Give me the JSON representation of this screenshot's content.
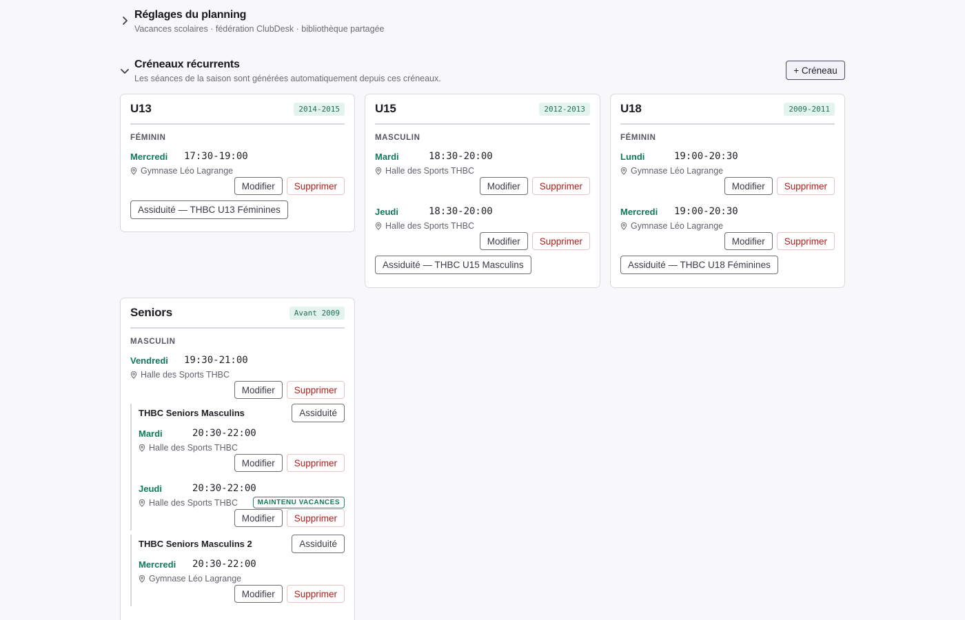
{
  "settings": {
    "title": "Réglages du planning",
    "subtitle": "Vacances scolaires · fédération ClubDesk · bibliothèque partagée"
  },
  "recurring": {
    "title": "Créneaux récurrents",
    "subtitle": "Les séances de la saison sont générées automatiquement depuis ces créneaux.",
    "add_label": "+ Créneau"
  },
  "labels": {
    "modify": "Modifier",
    "delete": "Supprimer",
    "attendance": "Assiduité",
    "holiday_badge": "MAINTENU VACANCES"
  },
  "cards": [
    {
      "title": "U13",
      "years": "2014-2015",
      "gender": "FÉMININ",
      "slots": [
        {
          "day": "Mercredi",
          "time": "17:30-19:00",
          "location": "Gymnase Léo Lagrange"
        }
      ],
      "attendance": "Assiduité — THBC U13 Féminines"
    },
    {
      "title": "U15",
      "years": "2012-2013",
      "gender": "MASCULIN",
      "slots": [
        {
          "day": "Mardi",
          "time": "18:30-20:00",
          "location": "Halle des Sports THBC"
        },
        {
          "day": "Jeudi",
          "time": "18:30-20:00",
          "location": "Halle des Sports THBC"
        }
      ],
      "attendance": "Assiduité — THBC U15 Masculins"
    },
    {
      "title": "U18",
      "years": "2009-2011",
      "gender": "FÉMININ",
      "slots": [
        {
          "day": "Lundi",
          "time": "19:00-20:30",
          "location": "Gymnase Léo Lagrange"
        },
        {
          "day": "Mercredi",
          "time": "19:00-20:30",
          "location": "Gymnase Léo Lagrange"
        }
      ],
      "attendance": "Assiduité — THBC U18 Féminines"
    },
    {
      "title": "Seniors",
      "years": "Avant 2009",
      "gender": "MASCULIN",
      "slots": [
        {
          "day": "Vendredi",
          "time": "19:30-21:00",
          "location": "Halle des Sports THBC"
        }
      ],
      "groups": [
        {
          "name": "THBC Seniors Masculins",
          "slots": [
            {
              "day": "Mardi",
              "time": "20:30-22:00",
              "location": "Halle des Sports THBC"
            },
            {
              "day": "Jeudi",
              "time": "20:30-22:00",
              "location": "Halle des Sports THBC",
              "badge": true
            }
          ]
        },
        {
          "name": "THBC Seniors Masculins 2",
          "slots": [
            {
              "day": "Mercredi",
              "time": "20:30-22:00",
              "location": "Gymnase Léo Lagrange"
            }
          ]
        }
      ]
    }
  ]
}
